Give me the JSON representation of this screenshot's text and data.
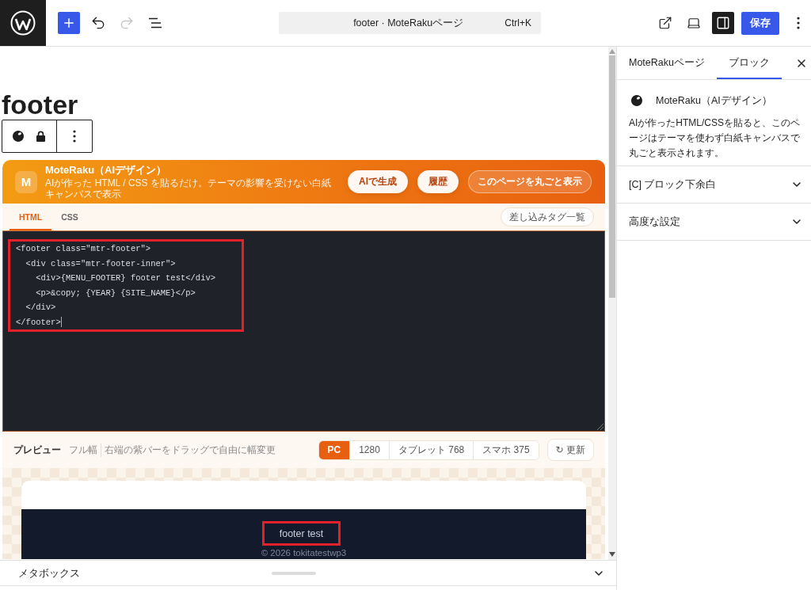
{
  "top_bar": {
    "undo": {
      "disabled": false
    },
    "redo": {
      "disabled": true
    },
    "command_center": {
      "title": "footer · MoteRakuページ",
      "shortcut": "Ctrl+K"
    },
    "settings_toggle": {
      "on": true
    },
    "save_button": "保存"
  },
  "editor": {
    "title": "footer",
    "block": {
      "header": {
        "logo": "M",
        "title": "MoteRaku（AIデザイン）",
        "subtitle": "AIが作った HTML / CSS を貼るだけ。テーマの影響を受けない白紙キャンバスで表示",
        "actions": [
          {
            "label": "AIで生成",
            "kind": "solid"
          },
          {
            "label": "履歴",
            "kind": "solid"
          },
          {
            "label": "このページを丸ごと表示",
            "kind": "outline"
          }
        ]
      },
      "tabs": [
        {
          "label": "HTML",
          "selected": true
        },
        {
          "label": "CSS",
          "selected": false
        }
      ],
      "tag_list_button": "差し込みタグ一覧",
      "code": {
        "highlighted": true,
        "lines": [
          "<footer class=\"mtr-footer\">",
          "  <div class=\"mtr-footer-inner\">",
          "    <div>{MENU_FOOTER} footer test</div>",
          "    <p>&copy; {YEAR} {SITE_NAME}</p>",
          "  </div>",
          "</footer>"
        ]
      },
      "preview": {
        "label": "プレビュー",
        "mode": "フル幅",
        "hint": "右端の紫バーをドラッグで自由に幅変更",
        "sizes": [
          {
            "label": "PC",
            "selected": true
          },
          {
            "label": "1280",
            "selected": false
          },
          {
            "label": "タブレット 768",
            "selected": false
          },
          {
            "label": "スマホ 375",
            "selected": false
          }
        ],
        "refresh_button": "↻ 更新",
        "site_footer": {
          "menu_text": "footer test",
          "menu_highlighted": true,
          "copyright": "© 2026 tokitatestwp3"
        }
      }
    }
  },
  "metabox": {
    "label": "メタボックス"
  },
  "sidebar": {
    "tabs": [
      {
        "label": "MoteRakuページ",
        "selected": false
      },
      {
        "label": "ブロック",
        "selected": true
      }
    ],
    "block_card": {
      "title": "MoteRaku（AIデザイン）",
      "description": "AIが作ったHTML/CSSを貼ると、このページはテーマを使わず白紙キャンバスで丸ごと表示されます。"
    },
    "panels": [
      {
        "title": "[C] ブロック下余白",
        "expanded": false
      },
      {
        "title": "高度な設定",
        "expanded": false
      }
    ]
  }
}
